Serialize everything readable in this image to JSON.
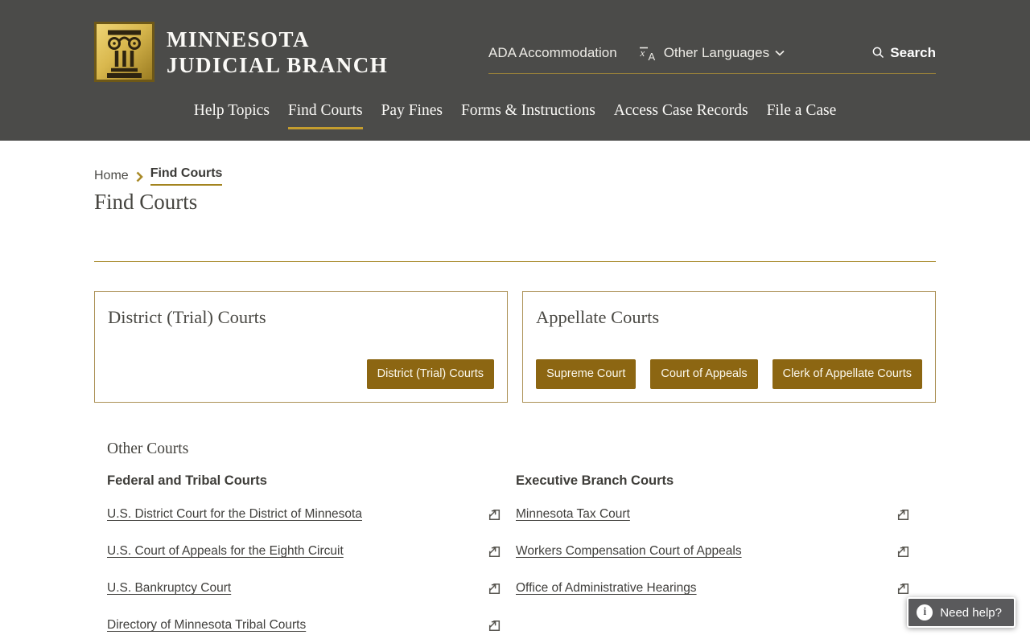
{
  "brand": {
    "line1": "MINNESOTA",
    "line2": "JUDICIAL BRANCH"
  },
  "utility": {
    "ada": "ADA Accommodation",
    "languages": "Other Languages",
    "search": "Search"
  },
  "nav": {
    "items": [
      "Help Topics",
      "Find Courts",
      "Pay Fines",
      "Forms & Instructions",
      "Access Case Records",
      "File a Case"
    ],
    "active": "Find Courts"
  },
  "breadcrumb": {
    "home": "Home",
    "current": "Find Courts"
  },
  "page": {
    "title": "Find Courts"
  },
  "cards": [
    {
      "title": "District (Trial) Courts",
      "buttons": [
        "District (Trial) Courts"
      ]
    },
    {
      "title": "Appellate Courts",
      "buttons": [
        "Supreme Court",
        "Court of Appeals",
        "Clerk of Appellate Courts"
      ]
    }
  ],
  "other_courts": {
    "title": "Other Courts",
    "columns": [
      {
        "heading": "Federal and Tribal Courts",
        "links": [
          "U.S. District Court for the District of Minnesota",
          "U.S. Court of Appeals for the Eighth Circuit",
          "U.S. Bankruptcy Court",
          "Directory of Minnesota Tribal Courts"
        ]
      },
      {
        "heading": "Executive Branch Courts",
        "links": [
          "Minnesota Tax Court",
          "Workers Compensation Court of Appeals",
          "Office of Administrative Hearings"
        ]
      }
    ]
  },
  "help": {
    "label": "Need help?"
  },
  "icons": {
    "translate": "translate-icon",
    "search": "search-icon",
    "external": "external-link-icon"
  },
  "colors": {
    "header_bg": "#4b4b49",
    "accent_gold": "#c49d2e",
    "rule_gold": "#a3841f",
    "button_brown": "#8c6612",
    "card_border": "#ac9156",
    "help_bg": "#5a5a5c"
  }
}
